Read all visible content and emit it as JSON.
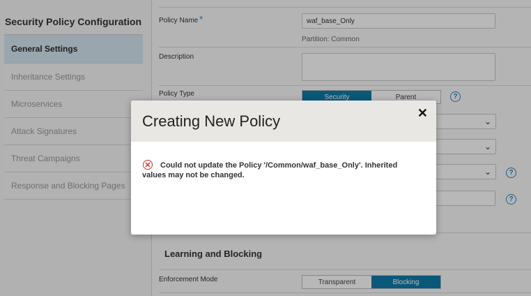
{
  "sidebar": {
    "title": "Security Policy Configuration",
    "items": [
      {
        "label": "General Settings",
        "active": true
      },
      {
        "label": "Inheritance Settings"
      },
      {
        "label": "Microservices"
      },
      {
        "label": "Attack Signatures"
      },
      {
        "label": "Threat Campaigns"
      },
      {
        "label": "Response and Blocking Pages"
      }
    ]
  },
  "form": {
    "policy_name_label": "Policy Name",
    "required_mark": "*",
    "policy_name_value": "waf_base_Only",
    "partition_text": "Partition: Common",
    "description_label": "Description",
    "policy_type_label": "Policy Type",
    "policy_type_options": [
      "Security",
      "Parent"
    ],
    "policy_type_selected": "Security",
    "section_learning": "Learning and Blocking",
    "enforcement_label": "Enforcement Mode",
    "enforcement_options": [
      "Transparent",
      "Blocking"
    ],
    "enforcement_selected": "Blocking",
    "help_glyph": "?"
  },
  "modal": {
    "title": "Creating New Policy",
    "close_glyph": "✕",
    "error_glyph": "✕",
    "error_message": "Could not update the Policy '/Common/waf_base_Only'. Inherited values may not be changed."
  },
  "colors": {
    "accent": "#0f7ba8",
    "active_sidebar": "#d6e6f2",
    "error": "#d32f2f",
    "help": "#2a86c7"
  }
}
